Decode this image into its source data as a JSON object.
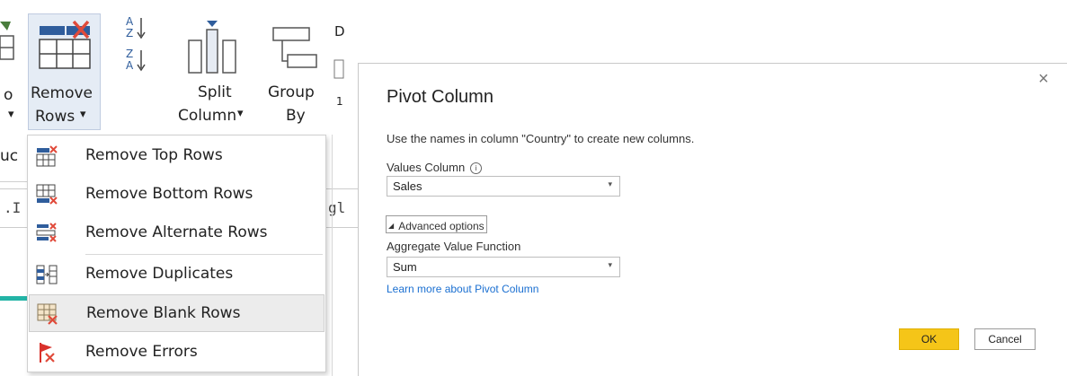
{
  "ribbon": {
    "remove_rows": {
      "line1": "Remove",
      "line2": "Rows",
      "caret": "▾"
    },
    "split_column": {
      "line1": "Split",
      "line2": "Column",
      "caret": "▾"
    },
    "group_by": {
      "line1": "Group",
      "line2": "By"
    },
    "left_caret": "▾",
    "sort_asc_letters": [
      "A",
      "Z"
    ],
    "sort_desc_letters": [
      "Z",
      "A"
    ]
  },
  "background_fragments": {
    "formula_left": ".I",
    "formula_right": "gl",
    "ribbon_num": "1",
    "group_cut": "uc"
  },
  "menu": {
    "items": [
      {
        "label": "Remove Top Rows",
        "icon": "remove-top-rows-icon"
      },
      {
        "label": "Remove Bottom Rows",
        "icon": "remove-bottom-rows-icon"
      },
      {
        "label": "Remove Alternate Rows",
        "icon": "remove-alternate-rows-icon"
      },
      {
        "label": "Remove Duplicates",
        "icon": "remove-duplicates-icon"
      },
      {
        "label": "Remove Blank Rows",
        "icon": "remove-blank-rows-icon"
      },
      {
        "label": "Remove Errors",
        "icon": "remove-errors-icon"
      }
    ]
  },
  "dialog": {
    "title": "Pivot Column",
    "description": "Use the names in column \"Country\" to create new columns.",
    "values_label": "Values Column",
    "info_glyph": "i",
    "values_selected": "Sales",
    "advanced_toggle": "Advanced options",
    "aggregate_label": "Aggregate Value Function",
    "aggregate_selected": "Sum",
    "learn_more": "Learn more about Pivot Column",
    "ok_label": "OK",
    "cancel_label": "Cancel",
    "close_glyph": "×"
  },
  "colors": {
    "accent_teal": "#23b4a6",
    "ok_yellow": "#f5c518",
    "link_blue": "#1a6fd1",
    "error_red": "#d9322c",
    "ribbon_blue": "#3a6fb0"
  }
}
